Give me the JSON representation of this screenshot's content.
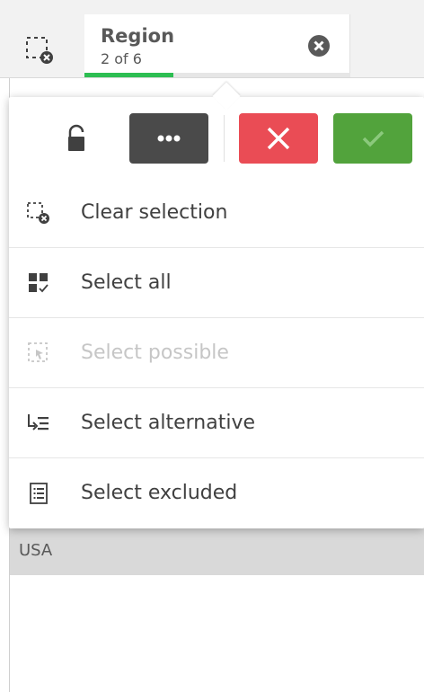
{
  "selection_bar": {
    "field_name": "Region",
    "count_text": "2 of 6",
    "selected_fraction": 0.333,
    "progress_color": "#2dbe52"
  },
  "toolbar": {
    "lock_icon": "lock-open-icon",
    "more_icon": "more-horizontal-icon",
    "cancel_icon": "close-icon",
    "confirm_icon": "checkmark-icon",
    "cancel_color": "#ea4c55",
    "confirm_color": "#52a33c",
    "more_color": "#4a4a4a"
  },
  "menu": {
    "items": [
      {
        "label": "Clear selection",
        "icon": "clear-selections-icon",
        "enabled": true
      },
      {
        "label": "Select all",
        "icon": "select-all-icon",
        "enabled": true
      },
      {
        "label": "Select possible",
        "icon": "select-possible-icon",
        "enabled": false
      },
      {
        "label": "Select alternative",
        "icon": "select-alternative-icon",
        "enabled": true
      },
      {
        "label": "Select excluded",
        "icon": "select-excluded-icon",
        "enabled": true
      }
    ]
  },
  "listbox": {
    "rows": [
      {
        "value": "USA",
        "state": "selected"
      }
    ]
  }
}
